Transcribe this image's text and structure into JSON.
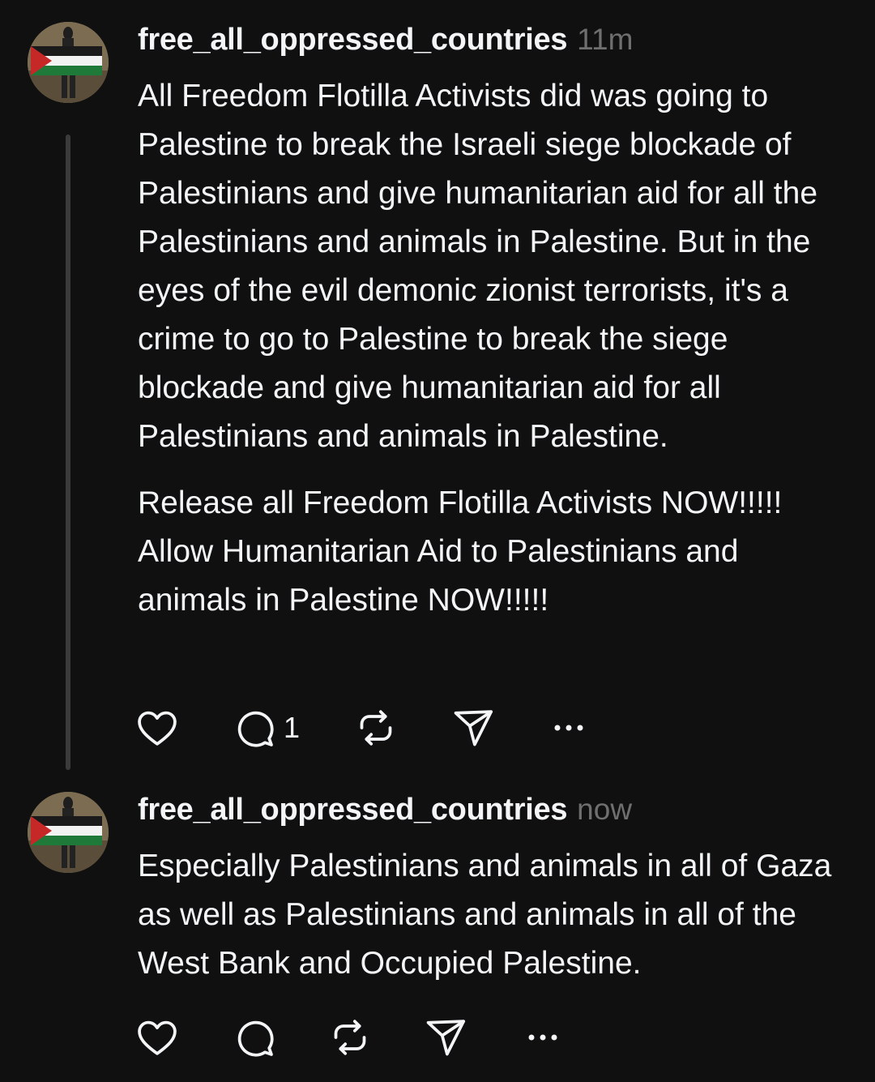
{
  "posts": [
    {
      "username": "free_all_oppressed_countries",
      "timestamp": "11m",
      "paragraphs": [
        "All Freedom Flotilla Activists did was going to Palestine to break the Israeli siege blockade of Palestinians and give humanitarian aid for all the Palestinians and animals in Palestine. But in the eyes of the evil demonic zionist terrorists, it's a crime to go to Palestine to break the siege blockade and give humanitarian aid for all Palestinians and animals in Palestine.",
        "Release all Freedom Flotilla Activists NOW!!!!! Allow Humanitarian Aid to Palestinians and animals in Palestine NOW!!!!!"
      ],
      "reply_count": "1"
    },
    {
      "username": "free_all_oppressed_countries",
      "timestamp": "now",
      "paragraphs": [
        "Especially Palestinians and animals in all of Gaza as well as Palestinians and animals in all of the West Bank and Occupied Palestine."
      ],
      "reply_count": ""
    }
  ],
  "icons": {
    "like": "heart-icon",
    "reply": "comment-bubble-icon",
    "repost": "repost-icon",
    "share": "send-icon",
    "more": "more-options-icon"
  },
  "colors": {
    "background": "#101010",
    "text": "#f3f5f7",
    "secondary_text": "#6f6f6f",
    "thread_line": "#3b3b3b"
  }
}
